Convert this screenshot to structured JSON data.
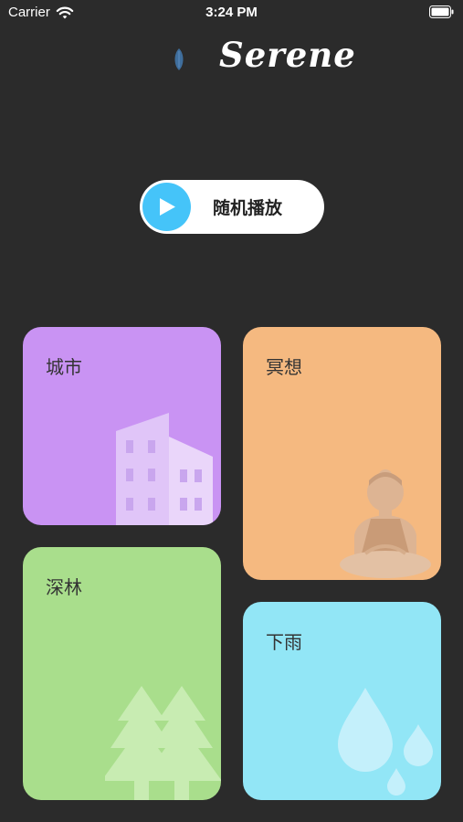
{
  "status_bar": {
    "carrier": "Carrier",
    "time": "3:24 PM"
  },
  "header": {
    "brand": "Serene",
    "logo_icon": "leaf-icon"
  },
  "random_play": {
    "label": "随机播放",
    "icon": "play-icon",
    "accent": "#45c4f9"
  },
  "cards": [
    {
      "id": "city",
      "label": "城市",
      "icon": "buildings-icon",
      "color": "#c993f3"
    },
    {
      "id": "meditation",
      "label": "冥想",
      "icon": "meditating-person-icon",
      "color": "#f5b980"
    },
    {
      "id": "forest",
      "label": "深林",
      "icon": "pine-trees-icon",
      "color": "#a9de8c"
    },
    {
      "id": "rain",
      "label": "下雨",
      "icon": "raindrops-icon",
      "color": "#92e6f6"
    }
  ],
  "colors": {
    "background": "#2b2b2b"
  }
}
